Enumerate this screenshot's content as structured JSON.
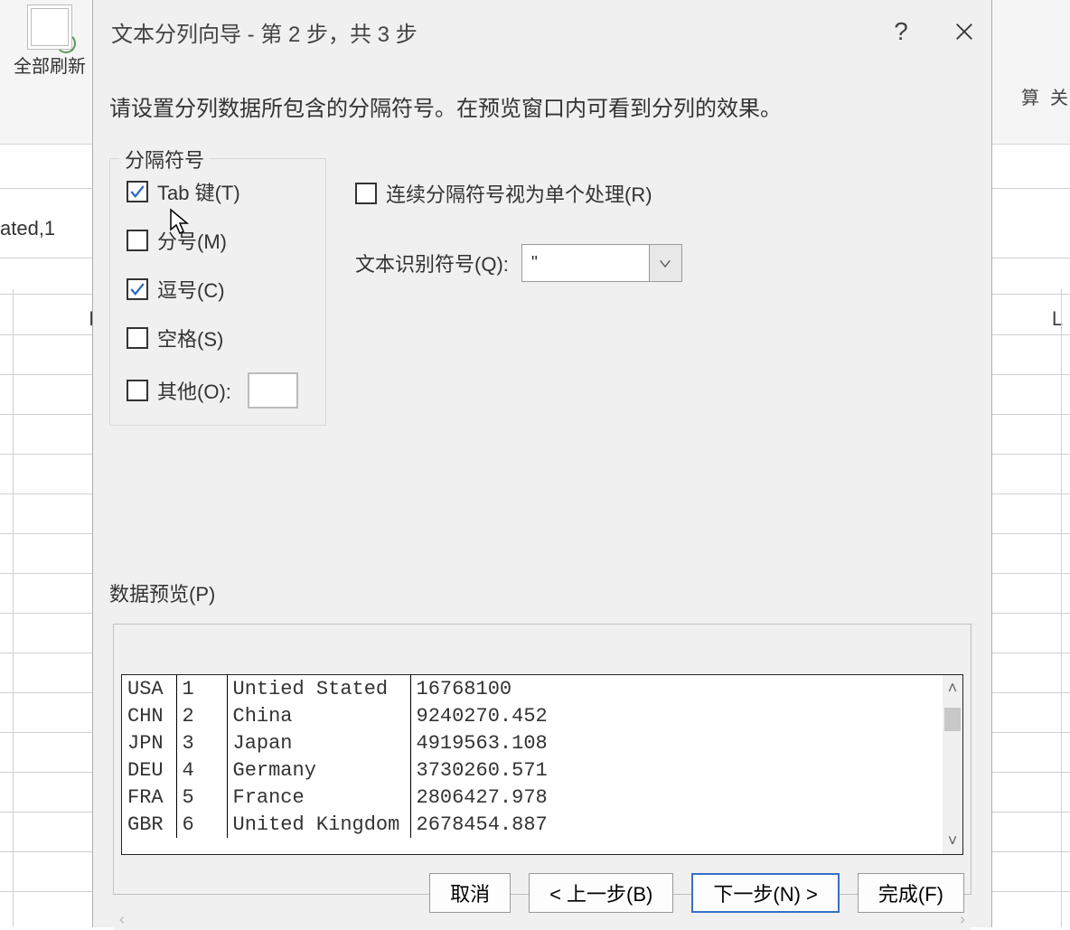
{
  "background": {
    "refresh_label": "全部刷新",
    "cell_text": "ated,1",
    "col_f": "F",
    "col_l": "L",
    "calc_label": "算",
    "rel_label": "关"
  },
  "dialog": {
    "title": "文本分列向导 - 第 2 步，共 3 步",
    "instruction": "请设置分列数据所包含的分隔符号。在预览窗口内可看到分列的效果。",
    "delimiters_legend": "分隔符号",
    "checkboxes": {
      "tab": {
        "label": "Tab 键(T)",
        "checked": true
      },
      "semicolon": {
        "label": "分号(M)",
        "checked": false
      },
      "comma": {
        "label": "逗号(C)",
        "checked": true
      },
      "space": {
        "label": "空格(S)",
        "checked": false
      },
      "other": {
        "label": "其他(O):",
        "checked": false
      }
    },
    "consecutive": {
      "label": "连续分隔符号视为单个处理(R)",
      "checked": false
    },
    "qualifier_label": "文本识别符号(Q):",
    "qualifier_value": "\"",
    "preview_label": "数据预览(P)",
    "preview_rows": [
      {
        "c0": "USA",
        "c1": "1",
        "c2": "Untied Stated",
        "c3": "16768100"
      },
      {
        "c0": "CHN",
        "c1": "2",
        "c2": "China",
        "c3": "9240270.452"
      },
      {
        "c0": "JPN",
        "c1": "3",
        "c2": "Japan",
        "c3": "4919563.108"
      },
      {
        "c0": "DEU",
        "c1": "4",
        "c2": "Germany",
        "c3": "3730260.571"
      },
      {
        "c0": "FRA",
        "c1": "5",
        "c2": "France",
        "c3": "2806427.978"
      },
      {
        "c0": "GBR",
        "c1": "6",
        "c2": "United Kingdom",
        "c3": "2678454.887"
      }
    ],
    "buttons": {
      "cancel": "取消",
      "back": "< 上一步(B)",
      "next": "下一步(N) >",
      "finish": "完成(F)"
    }
  }
}
